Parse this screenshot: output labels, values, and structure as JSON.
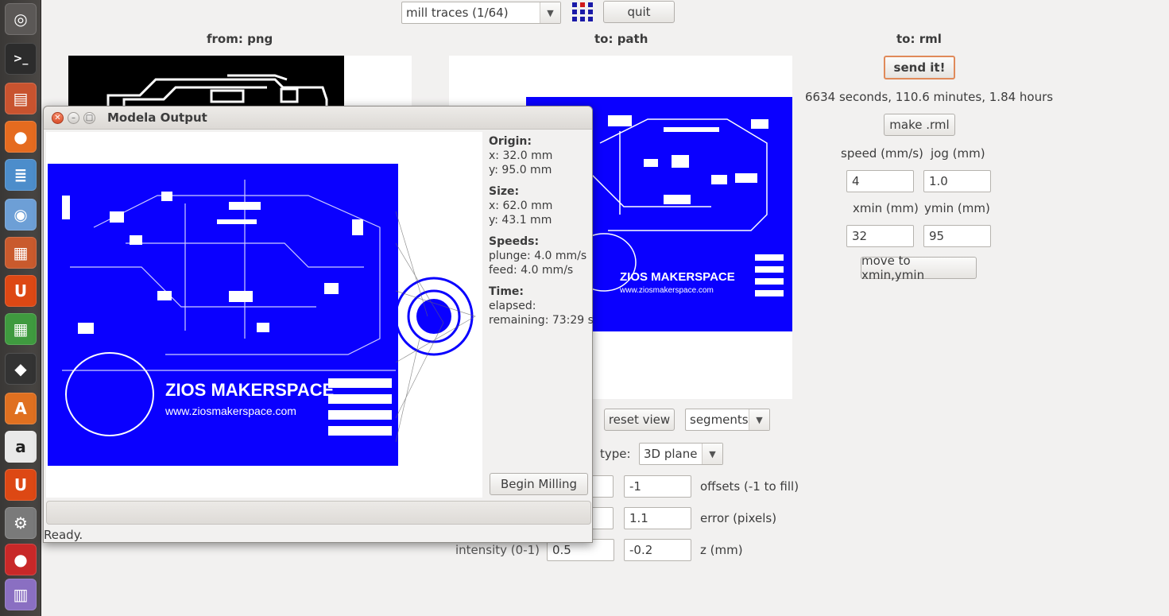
{
  "top": {
    "process_select": "mill traces (1/64)",
    "quit_label": "quit"
  },
  "columns": {
    "from": "from: png",
    "to_path": "to: path",
    "to_rml": "to: rml"
  },
  "rml": {
    "send_label": "send it!",
    "time_estimate": "6634 seconds, 110.6 minutes, 1.84 hours",
    "make_label": "make .rml",
    "speed_label": "speed (mm/s)",
    "jog_label": "jog (mm)",
    "speed_value": "4",
    "jog_value": "1.0",
    "xmin_label": "xmin (mm)",
    "ymin_label": "ymin (mm)",
    "xmin_value": "32",
    "ymin_value": "95",
    "move_label": "move to xmin,ymin"
  },
  "path": {
    "reset_label": "reset view",
    "display_select": "segments",
    "type_label": "type:",
    "type_select": "3D plane",
    "offsets_value": "-1",
    "offsets_label": "offsets (-1 to fill)",
    "error_value": "1.1",
    "error_label": "error (pixels)",
    "intensity_label": "intensity (0-1)",
    "intensity_value": "0.5",
    "z_value": "-0.2",
    "z_label": "z (mm)"
  },
  "dialog": {
    "title": "Modela Output",
    "origin_heading": "Origin:",
    "origin_x": "x: 32.0 mm",
    "origin_y": "y: 95.0 mm",
    "size_heading": "Size:",
    "size_x": "x: 62.0 mm",
    "size_y": "y: 43.1 mm",
    "speeds_heading": "Speeds:",
    "plunge": "plunge: 4.0 mm/s",
    "feed": "feed: 4.0 mm/s",
    "time_heading": "Time:",
    "elapsed": "elapsed:",
    "remaining": "remaining: 73:29 s",
    "begin_label": "Begin Milling",
    "status": "Ready."
  },
  "board": {
    "brand": "ZIOS MAKERSPACE",
    "url": "www.ziosmakerspace.com"
  },
  "colors": {
    "toolpath_blue": "#0a00ff",
    "send_border": "#e08a5a"
  },
  "launcher_icons": [
    "dash-icon",
    "terminal-icon",
    "files-icon",
    "firefox-icon",
    "writer-icon",
    "chromium-icon",
    "impress-icon",
    "ubuntu-one-icon",
    "calc-icon",
    "inkscape-icon",
    "software-center-icon",
    "amazon-icon",
    "ubuntu-one-music-icon",
    "settings-icon",
    "app-icon",
    "workspace-icon"
  ]
}
